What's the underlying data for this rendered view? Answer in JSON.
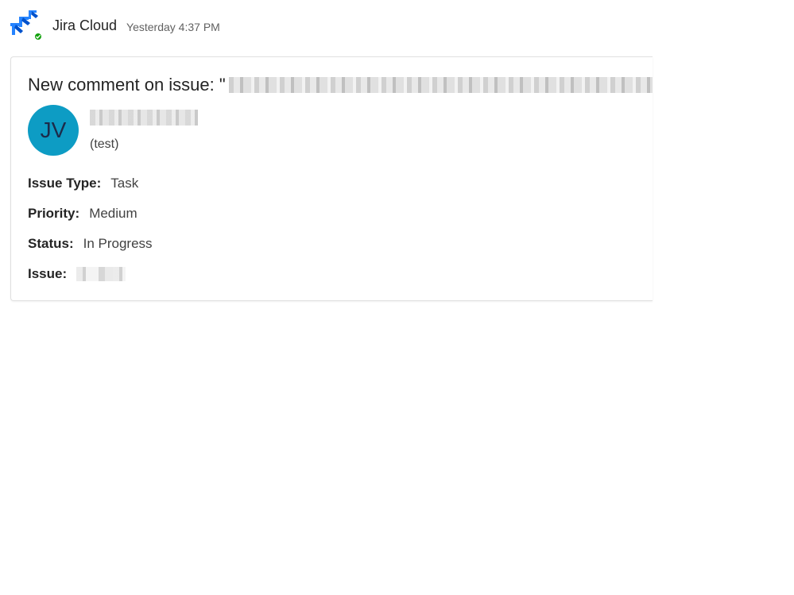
{
  "message": {
    "app_name": "Jira Cloud",
    "timestamp": "Yesterday 4:37 PM",
    "app_icon": "jira-logo",
    "presence_status": "available",
    "accent_color": "#0d9cc4"
  },
  "card": {
    "title_prefix": "New comment on issue: \"",
    "author_initials": "JV",
    "author_subtitle": "(test)",
    "facts": [
      {
        "label": "Issue Type:",
        "value": "Task"
      },
      {
        "label": "Priority:",
        "value": "Medium"
      },
      {
        "label": "Status:",
        "value": "In Progress"
      },
      {
        "label": "Issue:",
        "value": ""
      }
    ]
  }
}
